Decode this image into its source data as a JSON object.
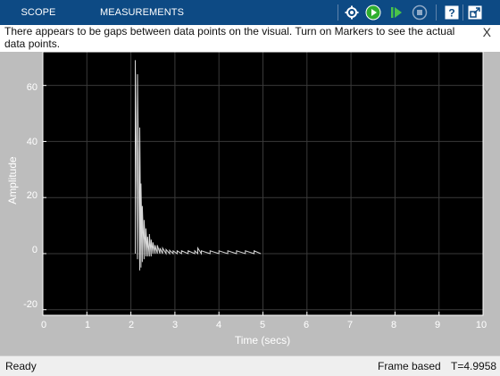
{
  "toolbar": {
    "tabs": [
      {
        "label": "SCOPE"
      },
      {
        "label": "MEASUREMENTS"
      }
    ],
    "buttons": [
      {
        "name": "settings-icon"
      },
      {
        "name": "run-icon"
      },
      {
        "name": "step-forward-icon"
      },
      {
        "name": "stop-icon"
      },
      {
        "name": "help-icon"
      },
      {
        "name": "undock-icon"
      }
    ],
    "background": "#0d4a84"
  },
  "notice": {
    "text": "There appears to be gaps between data points on the visual. Turn on Markers to see the actual data points.",
    "close": "X"
  },
  "status": {
    "left": "Ready",
    "mode": "Frame based",
    "time": "T=4.9958"
  },
  "chart_data": {
    "type": "line",
    "title": "",
    "xlabel": "Time (secs)",
    "ylabel": "Amplitude",
    "xlim": [
      0,
      10
    ],
    "ylim": [
      -22,
      72
    ],
    "xticks": [
      "0",
      "1",
      "2",
      "3",
      "4",
      "5",
      "6",
      "7",
      "8",
      "9",
      "10"
    ],
    "yticks": [
      "-20",
      "0",
      "20",
      "40",
      "60"
    ],
    "grid": true,
    "background": "#000000",
    "line_color": "#d8d8d8",
    "series": [
      {
        "x": [
          2.1,
          2.1,
          2.15,
          2.15,
          2.2,
          2.2,
          2.23,
          2.23,
          2.26,
          2.26,
          2.3,
          2.3,
          2.34,
          2.34,
          2.38,
          2.38,
          2.42,
          2.42,
          2.46,
          2.46,
          2.5,
          2.5,
          2.55,
          2.55,
          2.6,
          2.6,
          2.66,
          2.66,
          2.72,
          2.72,
          2.8,
          2.8,
          2.88,
          2.88,
          2.96,
          2.96,
          3.05,
          3.05,
          3.15,
          3.15,
          3.3,
          3.3,
          3.45,
          3.45,
          3.52,
          3.52,
          3.6,
          3.6,
          3.8,
          3.8,
          4.0,
          4.0,
          4.2,
          4.2,
          4.4,
          4.4,
          4.6,
          4.6,
          4.8,
          4.8,
          4.95
        ],
        "y": [
          0,
          69,
          -2,
          64,
          -6,
          45,
          -5,
          25,
          -3,
          17,
          -2,
          12,
          -1,
          9,
          -1,
          6,
          -1,
          7,
          -1,
          5,
          0,
          4,
          0,
          3,
          0,
          3,
          0,
          2,
          0,
          2,
          0,
          1.5,
          0,
          1.2,
          0,
          1,
          0,
          1,
          0,
          1,
          0,
          1,
          0,
          1,
          0,
          2,
          0,
          1,
          0,
          1,
          0,
          1,
          0,
          1,
          0,
          1,
          0,
          1,
          0,
          1,
          0
        ]
      }
    ]
  }
}
